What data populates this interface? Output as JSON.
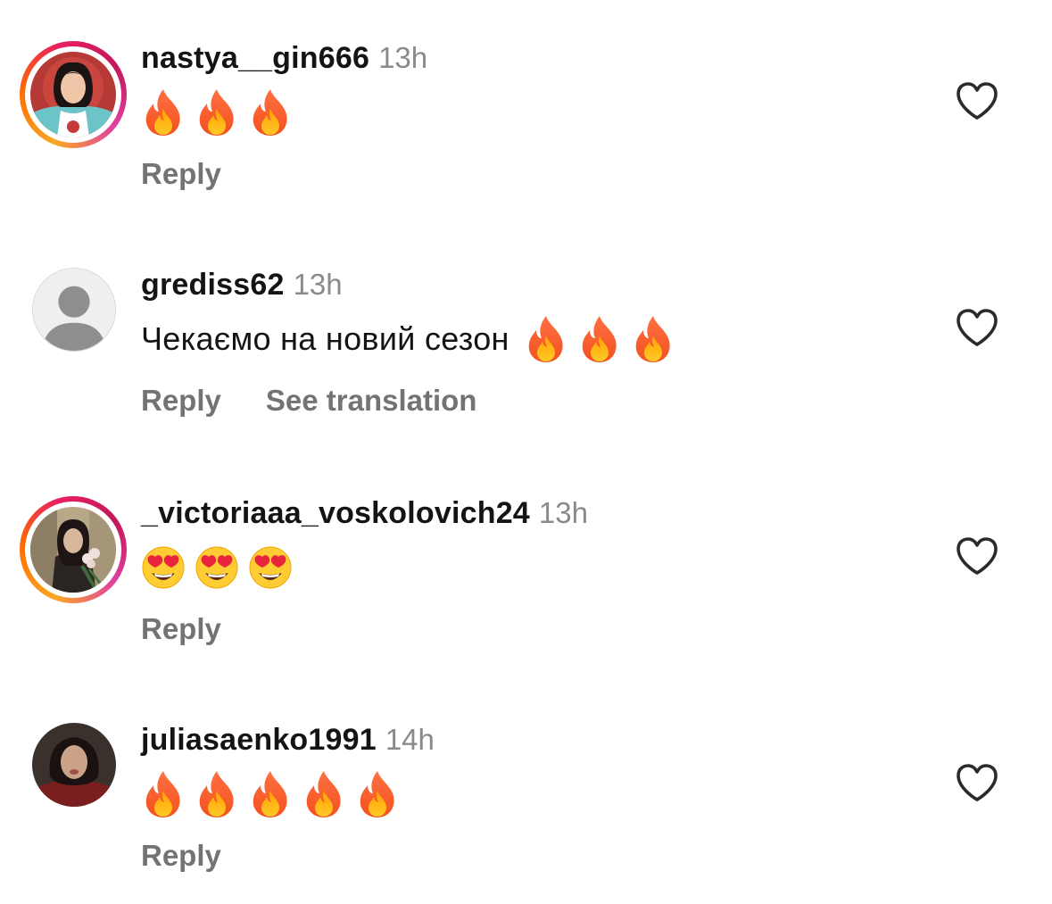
{
  "comments": [
    {
      "username": "nastya__gin666",
      "time": "13h",
      "text": "",
      "emoji_icon": "fire-emoji",
      "emoji_count": 3,
      "reply_label": "Reply",
      "translate_label": "",
      "avatar": "user-photo-avatar",
      "has_story_ring": true
    },
    {
      "username": "grediss62",
      "time": "13h",
      "text": "Чекаємо на новий сезон",
      "emoji_icon": "fire-emoji",
      "emoji_count": 3,
      "reply_label": "Reply",
      "translate_label": "See translation",
      "avatar": "default-avatar",
      "has_story_ring": false
    },
    {
      "username": "_victoriaaa_voskolovich24",
      "time": "13h",
      "text": "",
      "emoji_icon": "heart-eyes-emoji",
      "emoji_count": 3,
      "reply_label": "Reply",
      "translate_label": "",
      "avatar": "user-photo-avatar",
      "has_story_ring": true
    },
    {
      "username": "juliasaenko1991",
      "time": "14h",
      "text": "",
      "emoji_icon": "fire-emoji",
      "emoji_count": 5,
      "reply_label": "Reply",
      "translate_label": "",
      "avatar": "user-photo-avatar",
      "has_story_ring": false
    }
  ],
  "colors": {
    "username": "#141414",
    "timestamp": "#8a8a8a",
    "action": "#737373",
    "story_ring": [
      "#f9a825",
      "#e91e63"
    ]
  }
}
